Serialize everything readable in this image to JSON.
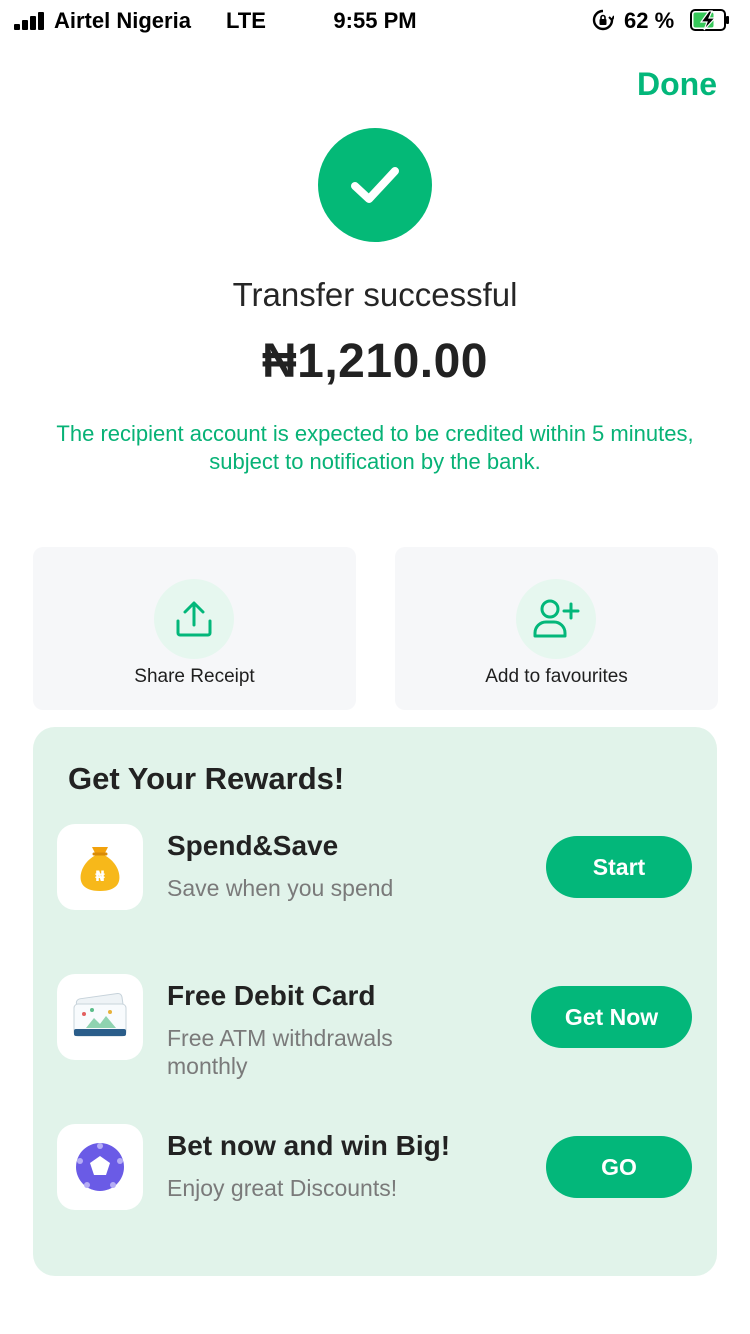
{
  "status_bar": {
    "carrier": "Airtel Nigeria",
    "network": "LTE",
    "time": "9:55 PM",
    "battery": "62 %"
  },
  "header": {
    "done_label": "Done"
  },
  "result": {
    "title": "Transfer successful",
    "amount": "₦1,210.00",
    "note": "The recipient account is expected to be credited within 5 minutes, subject to notification by the bank."
  },
  "actions": [
    {
      "label": "Share Receipt",
      "icon": "share-icon"
    },
    {
      "label": "Add to favourites",
      "icon": "add-user-icon"
    }
  ],
  "rewards": {
    "title": "Get Your Rewards!",
    "items": [
      {
        "name": "Spend&Save",
        "desc": "Save when you spend",
        "button": "Start",
        "icon": "money-bag-icon"
      },
      {
        "name": "Free Debit Card",
        "desc": "Free ATM withdrawals monthly",
        "button": "Get Now",
        "icon": "debit-card-icon"
      },
      {
        "name": "Bet now and win Big!",
        "desc": "Enjoy great Discounts!",
        "button": "GO",
        "icon": "soccer-ball-icon"
      }
    ]
  },
  "colors": {
    "accent": "#03b77a",
    "rewards_bg": "#e1f3ea",
    "card_bg": "#f6f7f9"
  }
}
